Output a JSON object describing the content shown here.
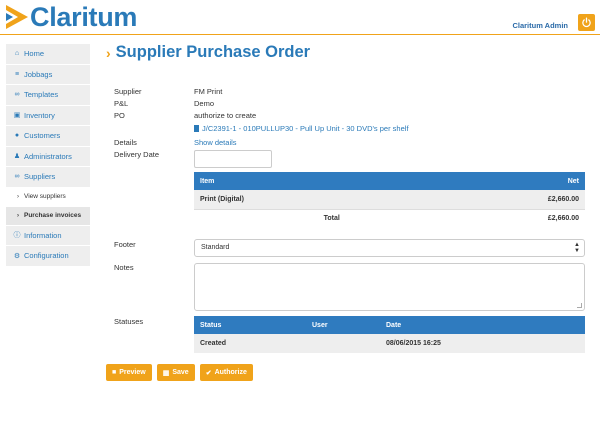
{
  "header": {
    "logo_text": "Claritum",
    "admin_name": "Claritum Admin",
    "power_icon": "power-icon",
    "brand_color": "#2a7ab8",
    "accent_color": "#f0a31a"
  },
  "sidebar": {
    "items": [
      {
        "label": "Home",
        "icon": "home-icon"
      },
      {
        "label": "Jobbags",
        "icon": "list-icon"
      },
      {
        "label": "Templates",
        "icon": "paperclip-icon"
      },
      {
        "label": "Inventory",
        "icon": "inventory-icon"
      },
      {
        "label": "Customers",
        "icon": "globe-icon"
      },
      {
        "label": "Administrators",
        "icon": "user-icon"
      },
      {
        "label": "Suppliers",
        "icon": "paperclip-icon"
      },
      {
        "label": "View suppliers",
        "icon": "chevron-right-icon"
      },
      {
        "label": "Purchase invoices",
        "icon": "chevron-right-icon"
      },
      {
        "label": "Information",
        "icon": "info-icon"
      },
      {
        "label": "Configuration",
        "icon": "gear-icon"
      }
    ]
  },
  "page": {
    "title": "Supplier Purchase Order"
  },
  "form": {
    "supplier_label": "Supplier",
    "supplier_value": "FM Print",
    "pl_label": "P&L",
    "pl_value": "Demo",
    "po_label": "PO",
    "po_value": "authorize to create",
    "job_link": "J/C2391-1 - 010PULLUP30 - Pull Up Unit - 30 DVD's per shelf",
    "details_label": "Details",
    "details_link": "Show details",
    "delivery_label": "Delivery Date",
    "delivery_value": "",
    "footer_label": "Footer",
    "footer_value": "Standard",
    "notes_label": "Notes",
    "notes_value": "",
    "statuses_label": "Statuses"
  },
  "items_table": {
    "headers": {
      "item": "Item",
      "net": "Net"
    },
    "rows": [
      {
        "item": "Print (Digital)",
        "net": "£2,660.00"
      }
    ],
    "total_label": "Total",
    "total_value": "£2,660.00"
  },
  "status_table": {
    "headers": {
      "status": "Status",
      "user": "User",
      "date": "Date"
    },
    "rows": [
      {
        "status": "Created",
        "user": "",
        "date": "08/06/2015 16:25"
      }
    ]
  },
  "actions": {
    "preview": "Preview",
    "save": "Save",
    "authorize": "Authorize"
  }
}
